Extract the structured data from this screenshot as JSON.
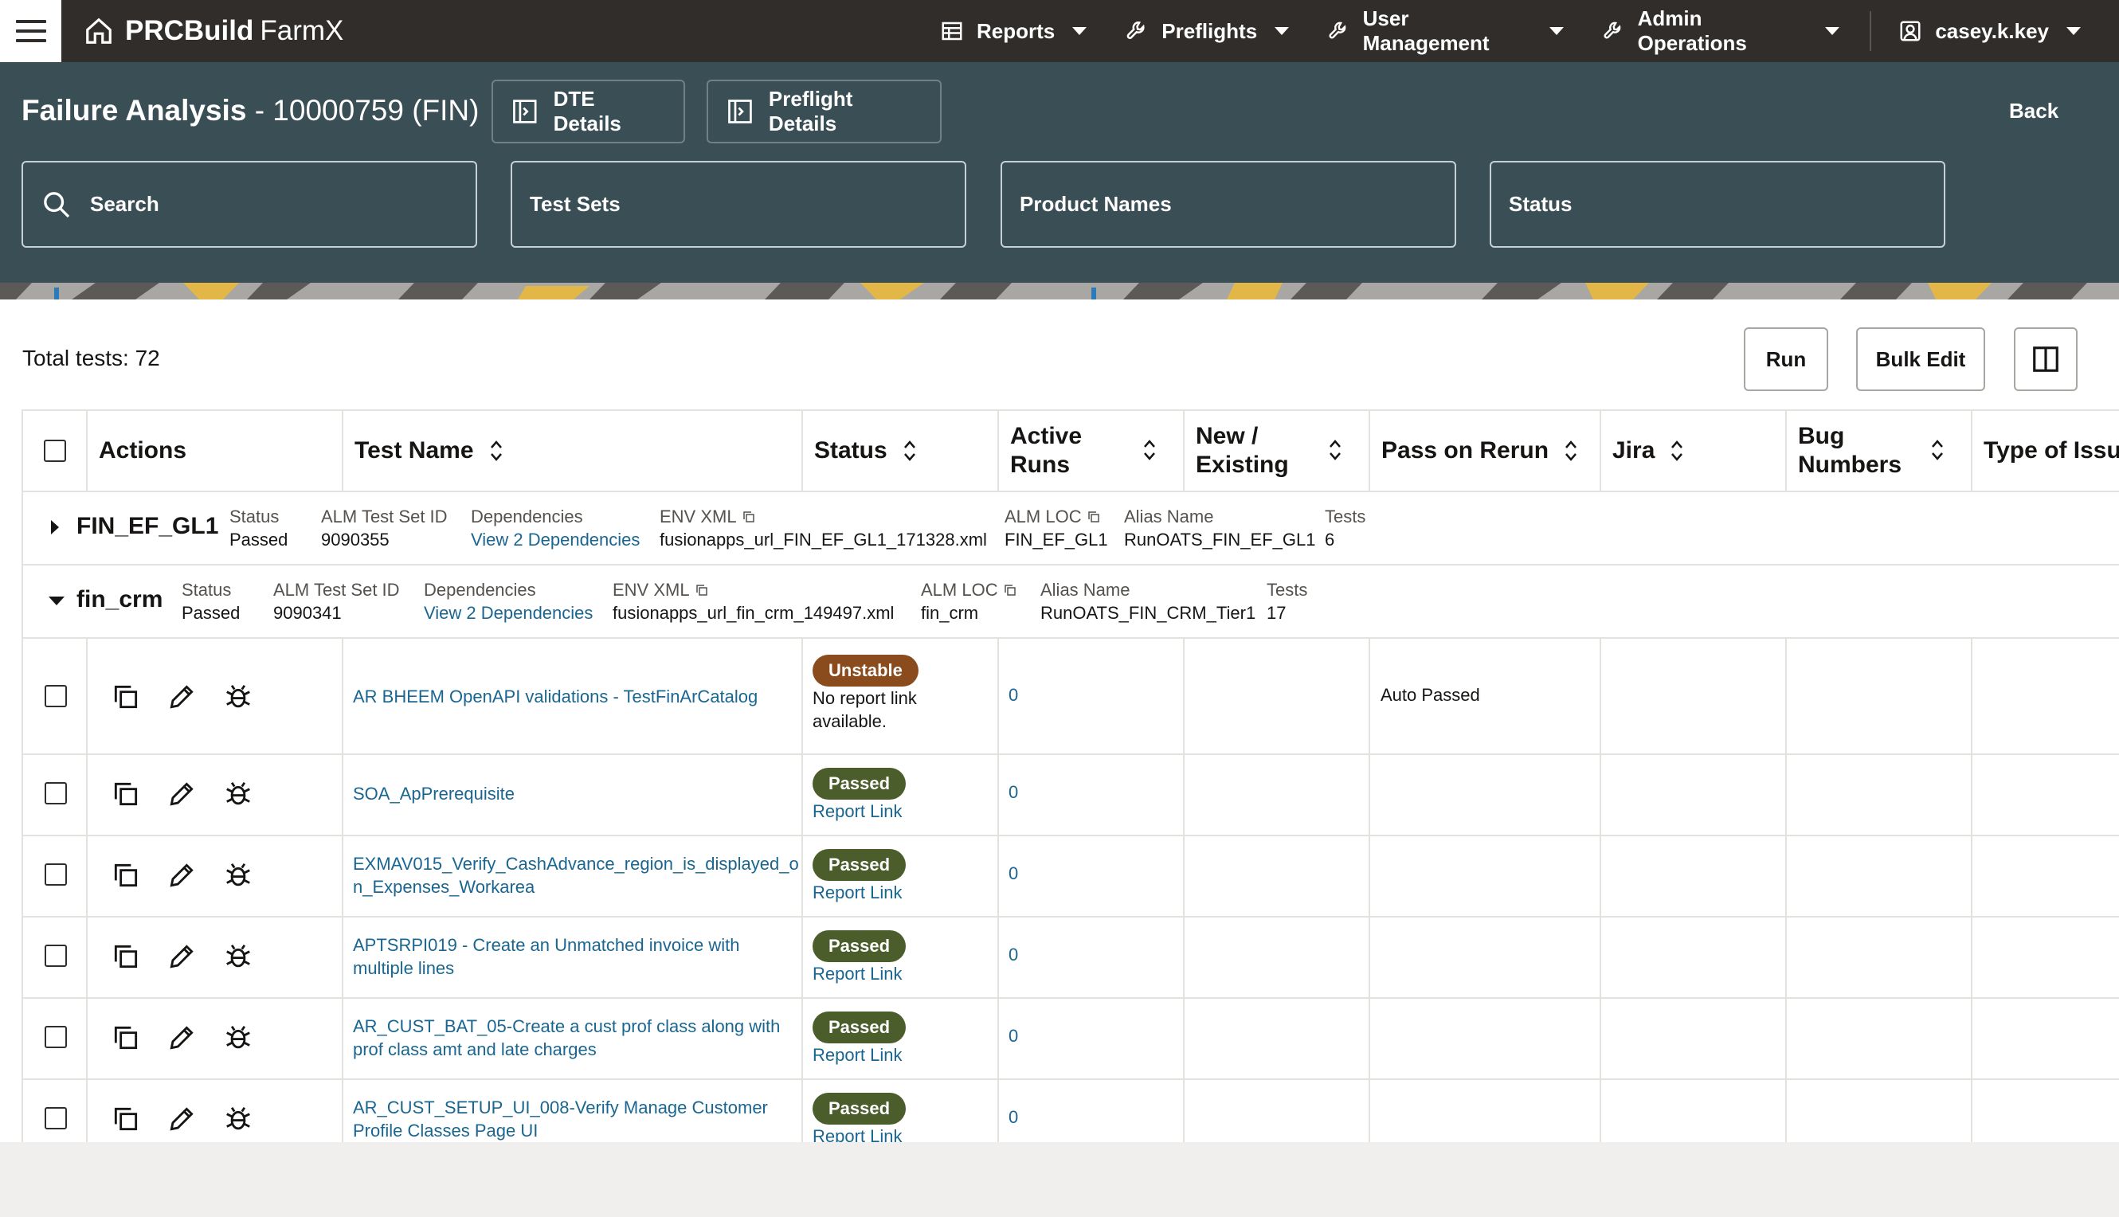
{
  "nav": {
    "brand_bold": "PRCBuild",
    "brand_light": "FarmX",
    "menus": [
      {
        "label": "Reports",
        "icon": "table-icon"
      },
      {
        "label": "Preflights",
        "icon": "wrench-icon"
      },
      {
        "label": "User Management",
        "icon": "wrench-icon"
      },
      {
        "label": "Admin Operations",
        "icon": "wrench-icon"
      }
    ],
    "user": "casey.k.key"
  },
  "header": {
    "title_bold": "Failure Analysis",
    "title_rest": " - 10000759 (FIN)",
    "dte_button": "DTE Details",
    "preflight_button": "Preflight Details",
    "back": "Back",
    "filters": {
      "search": "Search",
      "test_sets": "Test Sets",
      "product_names": "Product Names",
      "status": "Status"
    }
  },
  "toolbar": {
    "total": "Total tests: 72",
    "run": "Run",
    "bulk_edit": "Bulk Edit"
  },
  "table": {
    "columns": {
      "actions": "Actions",
      "test_name": "Test Name",
      "status": "Status",
      "active_runs_1": "Active",
      "active_runs_2": "Runs",
      "new_existing_1": "New /",
      "new_existing_2": "Existing",
      "pass_on_rerun": "Pass on Rerun",
      "jira": "Jira",
      "bug_numbers_1": "Bug",
      "bug_numbers_2": "Numbers",
      "type_of_issue": "Type of Issue"
    },
    "groups": [
      {
        "name": "FIN_EF_GL1",
        "expanded": false,
        "status_label": "Status",
        "status": "Passed",
        "alm_label": "ALM Test Set ID",
        "alm_id": "9090355",
        "dep_label": "Dependencies",
        "dep": "View 2 Dependencies",
        "env_label": "ENV XML",
        "env": "fusionapps_url_FIN_EF_GL1_171328.xml",
        "loc_label": "ALM LOC",
        "loc": "FIN_EF_GL1",
        "alias_label": "Alias Name",
        "alias": "RunOATS_FIN_EF_GL1",
        "tests_label": "Tests",
        "tests": "6"
      },
      {
        "name": "fin_crm",
        "expanded": true,
        "status_label": "Status",
        "status": "Passed",
        "alm_label": "ALM Test Set ID",
        "alm_id": "9090341",
        "dep_label": "Dependencies",
        "dep": "View 2 Dependencies",
        "env_label": "ENV XML",
        "env": "fusionapps_url_fin_crm_149497.xml",
        "loc_label": "ALM LOC",
        "loc": "fin_crm",
        "alias_label": "Alias Name",
        "alias": "RunOATS_FIN_CRM_Tier1",
        "tests_label": "Tests",
        "tests": "17"
      }
    ],
    "rows": [
      {
        "name_1": "AR BHEEM OpenAPI validations - TestFinArCatalog",
        "name_2": "",
        "status": "Unstable",
        "status_color": "#8a4b1d",
        "note_1": "No report link",
        "note_2": "available.",
        "active_runs": "0",
        "pass_on_rerun": "Auto Passed"
      },
      {
        "name_1": "SOA_ApPrerequisite",
        "name_2": "",
        "status": "Passed",
        "status_color": "#4a5d2b",
        "link": "Report Link",
        "active_runs": "0",
        "pass_on_rerun": ""
      },
      {
        "name_1": "EXMAV015_Verify_CashAdvance_region_is_displayed_o",
        "name_2": "n_Expenses_Workarea",
        "status": "Passed",
        "status_color": "#4a5d2b",
        "link": "Report Link",
        "active_runs": "0",
        "pass_on_rerun": ""
      },
      {
        "name_1": "APTSRPI019 - Create an Unmatched invoice with",
        "name_2": "multiple lines",
        "status": "Passed",
        "status_color": "#4a5d2b",
        "link": "Report Link",
        "active_runs": "0",
        "pass_on_rerun": ""
      },
      {
        "name_1": "AR_CUST_BAT_05-Create a cust prof class along with",
        "name_2": "prof class amt and late charges",
        "status": "Passed",
        "status_color": "#4a5d2b",
        "link": "Report Link",
        "active_runs": "0",
        "pass_on_rerun": ""
      },
      {
        "name_1": "AR_CUST_SETUP_UI_008-Verify Manage Customer",
        "name_2": "Profile Classes Page UI",
        "status": "Passed",
        "status_color": "#4a5d2b",
        "link": "Report Link",
        "active_runs": "0",
        "pass_on_rerun": ""
      }
    ]
  }
}
